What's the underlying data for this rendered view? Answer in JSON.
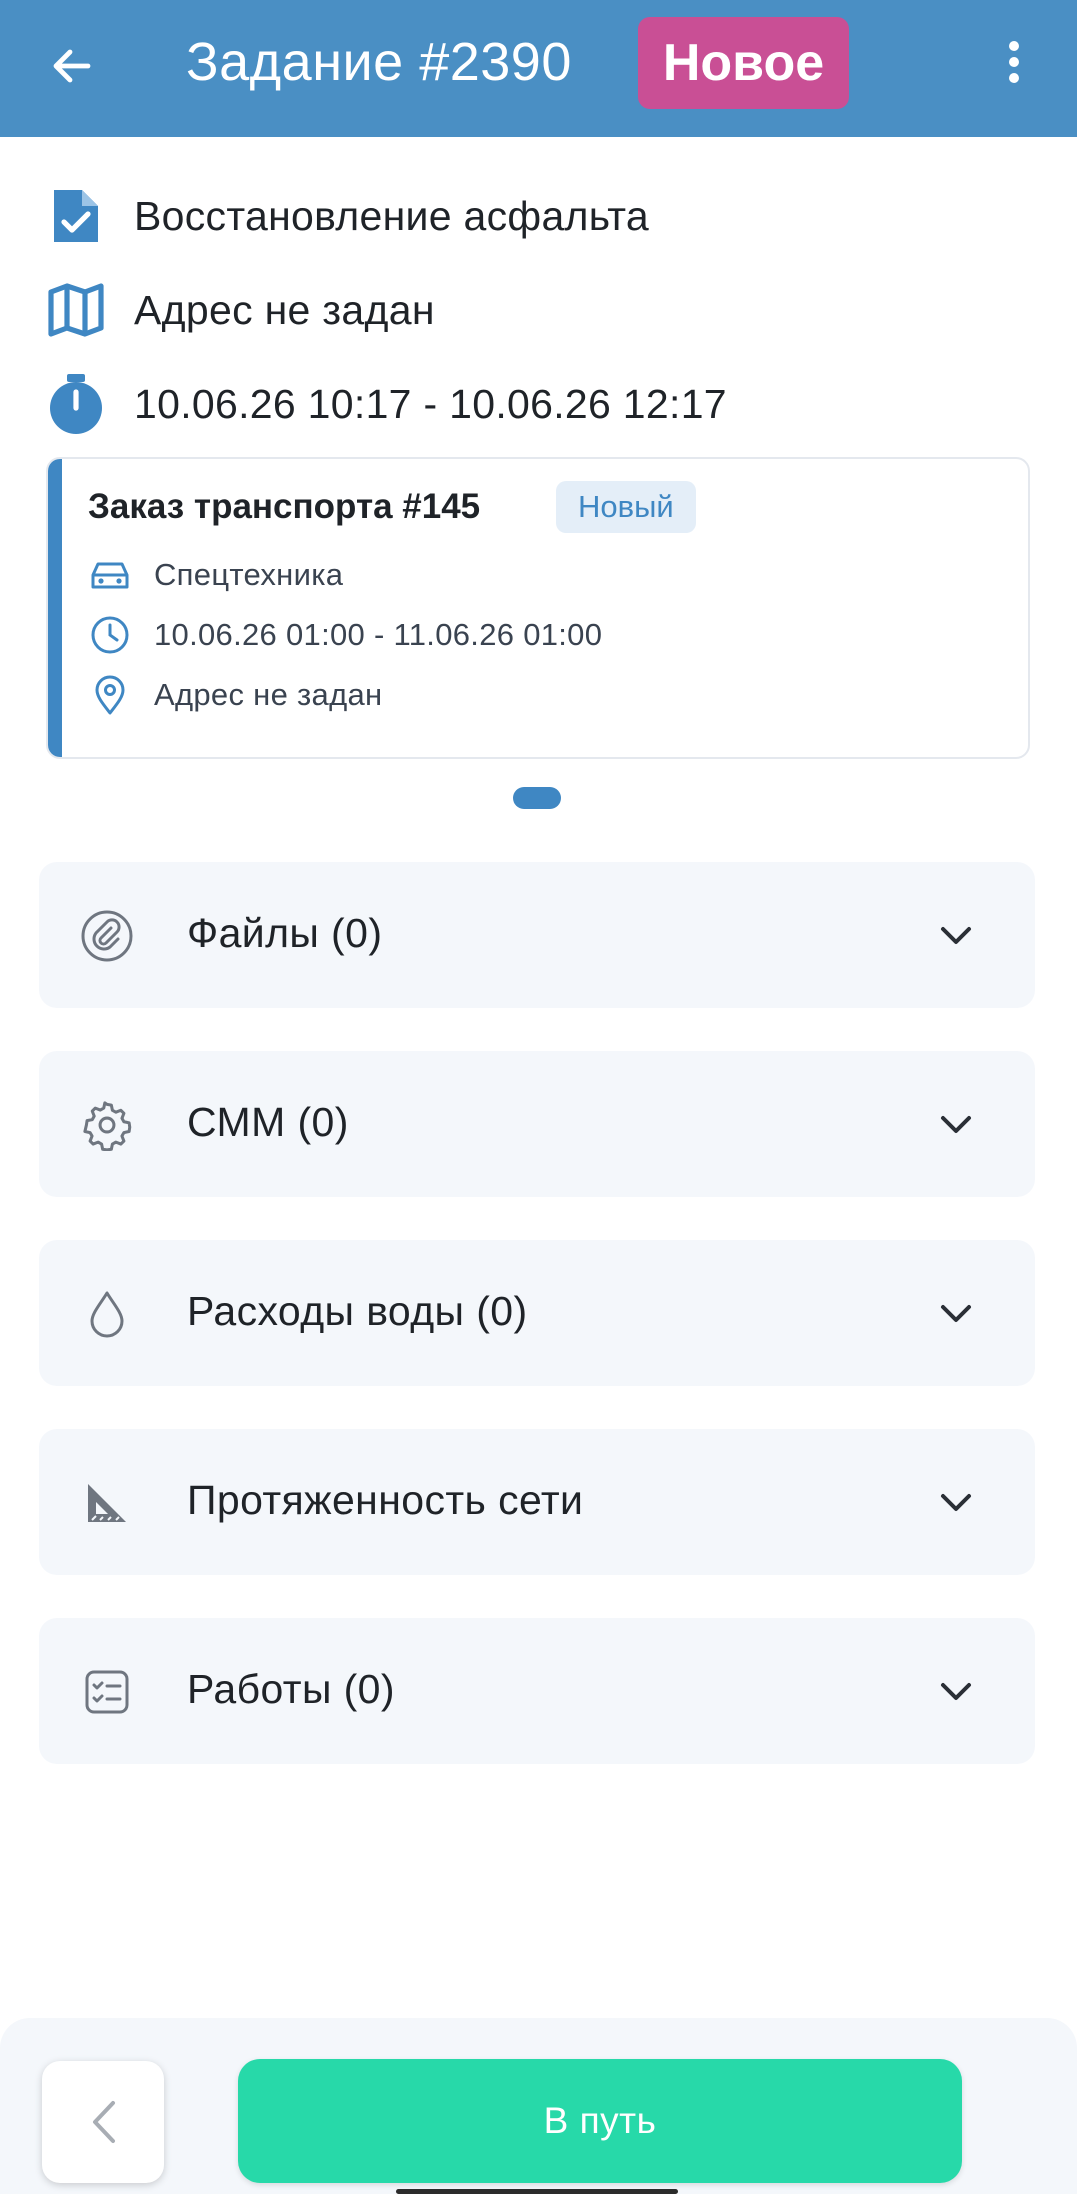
{
  "header": {
    "title": "Задание #2390",
    "status_badge": "Новое",
    "icons": {
      "back": "arrow-left-icon",
      "menu": "more-vertical-icon"
    },
    "colors": {
      "bar": "#4a8fc4",
      "badge": "#c94f95"
    }
  },
  "task": {
    "type": "Восстановление асфальта",
    "address": "Адрес не задан",
    "period": "10.06.26 10:17 - 10.06.26 12:17"
  },
  "transport_order": {
    "title": "Заказ транспорта #145",
    "status": "Новый",
    "vehicle": "Спецтехника",
    "period": "10.06.26 01:00 - 11.06.26 01:00",
    "address": "Адрес не задан"
  },
  "sections": [
    {
      "label": "Файлы (0)",
      "icon": "paperclip-icon"
    },
    {
      "label": "СММ (0)",
      "icon": "gear-icon"
    },
    {
      "label": "Расходы воды (0)",
      "icon": "water-drop-icon"
    },
    {
      "label": "Протяженность сети",
      "icon": "ruler-triangle-icon"
    },
    {
      "label": "Работы (0)",
      "icon": "checklist-icon"
    }
  ],
  "footer": {
    "primary_button": "В путь",
    "colors": {
      "primary": "#27d9a9"
    }
  }
}
